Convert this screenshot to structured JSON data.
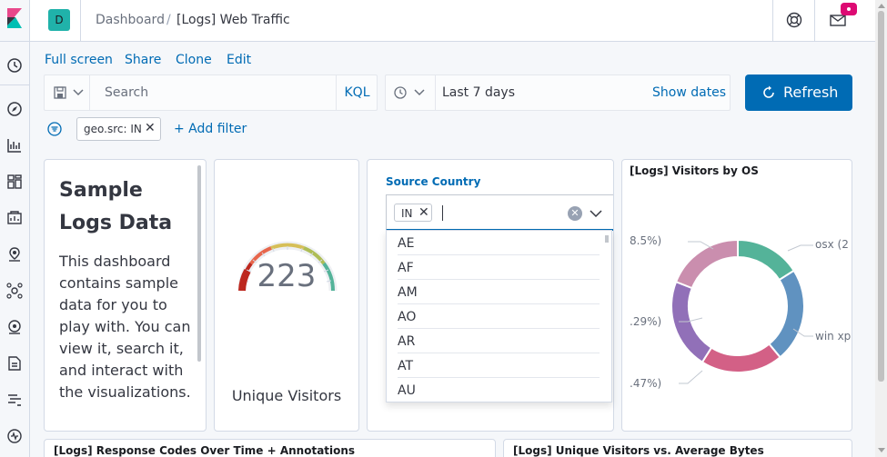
{
  "header": {
    "space_initial": "D",
    "breadcrumbs": [
      "Dashboard",
      "/",
      "[Logs] Web Traffic"
    ]
  },
  "top_menu": [
    "Full screen",
    "Share",
    "Clone",
    "Edit"
  ],
  "query": {
    "placeholder": "Search",
    "language": "KQL"
  },
  "time": {
    "range": "Last 7 days",
    "show_dates": "Show dates",
    "refresh": "Refresh"
  },
  "filters": {
    "items": [
      "geo.src: IN"
    ],
    "add_label": "+ Add filter"
  },
  "markdown_panel": {
    "title": "Sample Logs Data",
    "body": "This dashboard contains sample data for you to play with. You can view it, search it, and interact with the visualizations."
  },
  "gauge_panel": {
    "value": "223",
    "label": "Unique Visitors"
  },
  "control_panel": {
    "label": "Source Country",
    "selected": [
      "IN"
    ],
    "options": [
      "AE",
      "AF",
      "AM",
      "AO",
      "AR",
      "AT",
      "AU"
    ]
  },
  "os_panel": {
    "title": "[Logs] Visitors by OS",
    "labels": [
      "8.5%)",
      ".29%)",
      ".47%)",
      "osx (2",
      "win xp"
    ]
  },
  "chart_data": {
    "type": "pie",
    "title": "[Logs] Visitors by OS",
    "donut": true,
    "slices": [
      {
        "value": 0.16,
        "color": "#54b399"
      },
      {
        "value": 0.23,
        "color": "#6092c0"
      },
      {
        "value": 0.2,
        "color": "#d36086"
      },
      {
        "value": 0.22,
        "color": "#9170b8"
      },
      {
        "value": 0.19,
        "color": "#ca8eae"
      }
    ]
  },
  "bottom_panels": [
    "[Logs] Response Codes Over Time + Annotations",
    "[Logs] Unique Visitors vs. Average Bytes"
  ],
  "colors": {
    "accent": "#006bb4",
    "kibana_pink": "#e8488b",
    "kibana_teal": "#00bfb3",
    "notification": "#dd0a73",
    "space": "#20b2aa"
  }
}
